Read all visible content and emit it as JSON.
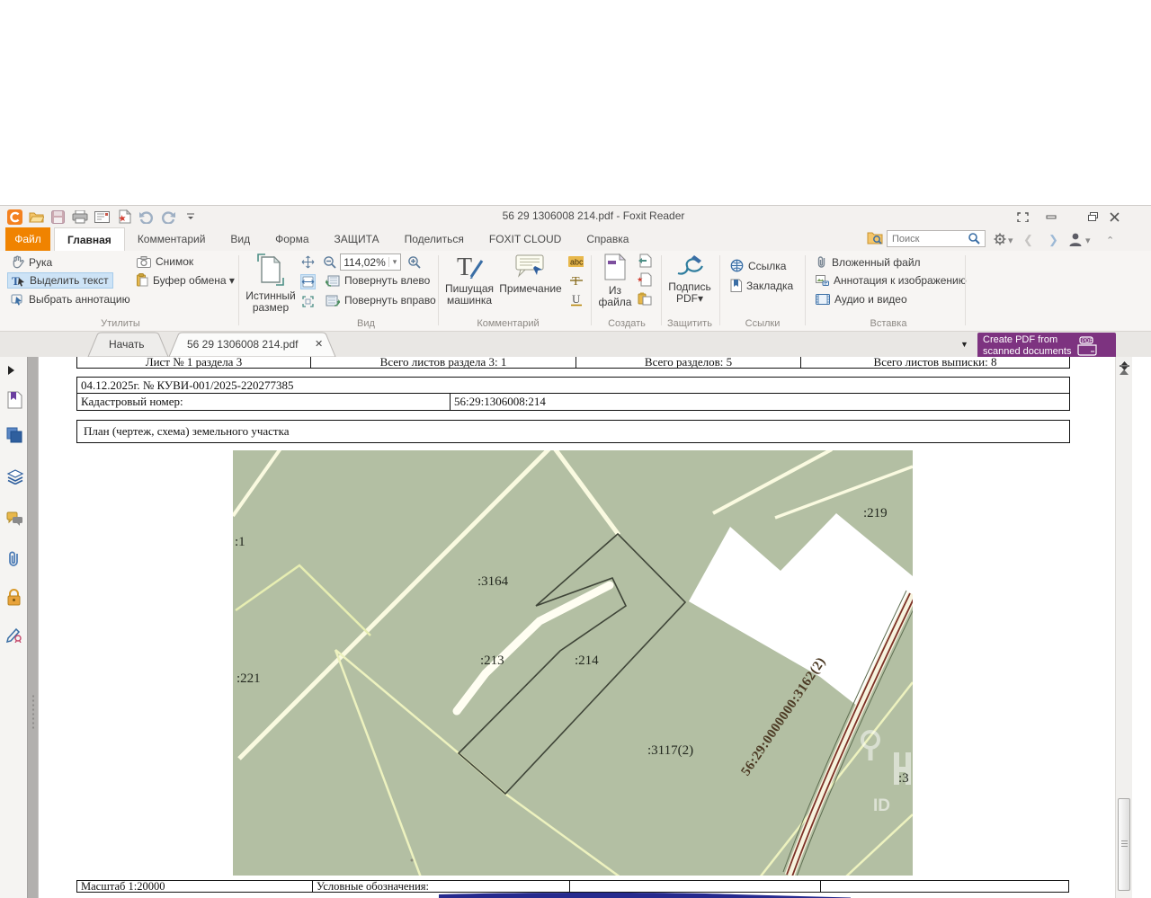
{
  "colors": {
    "accent_orange": "#F08300",
    "badge_purple": "#7D3380",
    "selection_blue": "#CDE3F6",
    "map_green": "#B3BFA3",
    "road_brown": "#7C3126",
    "bottom_bar_blue": "#262A8E"
  },
  "titlebar": {
    "title": "56 29 1306008 214.pdf - Foxit Reader"
  },
  "menu": {
    "file": "Файл",
    "tabs": [
      "Главная",
      "Комментарий",
      "Вид",
      "Форма",
      "ЗАЩИТА",
      "Поделиться",
      "FOXIT CLOUD",
      "Справка"
    ],
    "active_tab": "Главная"
  },
  "search": {
    "placeholder": "Поиск"
  },
  "ribbon": {
    "utilities": {
      "label": "Утилиты",
      "hand": "Рука",
      "select_text": "Выделить текст",
      "select_annotation": "Выбрать аннотацию",
      "snapshot": "Снимок",
      "clipboard": "Буфер обмена ▾"
    },
    "view": {
      "label": "Вид",
      "true_size_1": "Истинный",
      "true_size_2": "размер",
      "zoom_value": "114,02%",
      "rotate_left": "Повернуть влево",
      "rotate_right": "Повернуть вправо"
    },
    "comment": {
      "label": "Комментарий",
      "typewriter_1": "Пишущая",
      "typewriter_2": "машинка",
      "note": "Примечание",
      "highlight": "abc",
      "strikeout": "T",
      "underline": "U"
    },
    "create": {
      "label": "Создать",
      "from_file_1": "Из",
      "from_file_2": "файла"
    },
    "protect": {
      "label": "Защитить",
      "sign_1": "Подпись",
      "sign_2": "PDF▾"
    },
    "links": {
      "label": "Ссылки",
      "link": "Ссылка",
      "bookmark": "Закладка"
    },
    "insert": {
      "label": "Вставка",
      "attach": "Вложенный файл",
      "image_annotation": "Аннотация к изображению",
      "audio_video": "Аудио и видео"
    }
  },
  "tabs_bar": {
    "start_tab": "Начать",
    "doc_tab": "56 29 1306008 214.pdf",
    "close_glyph": "✕"
  },
  "badge": {
    "line1": "Create PDF from",
    "line2": "scanned documents"
  },
  "document": {
    "header_row": [
      "Лист № 1 раздела 3",
      "Всего листов раздела 3: 1",
      "Всего разделов: 5",
      "Всего листов выписки: 8"
    ],
    "request_line": "04.12.2025г. № КУВИ-001/2025-220277385",
    "cadastral_label": "Кадастровый номер:",
    "cadastral_value": "56:29:1306008:214",
    "plan_title": "План (чертеж, схема) земельного участка",
    "scale": "Масштаб 1:20000",
    "legend_label": "Условные обозначения:",
    "map": {
      "labels": [
        ":1",
        ":3164",
        ":219",
        ":213",
        ":214",
        ":221",
        ":3117(2)",
        ":3"
      ],
      "road_label": "56:29:0000000:3162(2)",
      "watermark": "ID"
    }
  }
}
